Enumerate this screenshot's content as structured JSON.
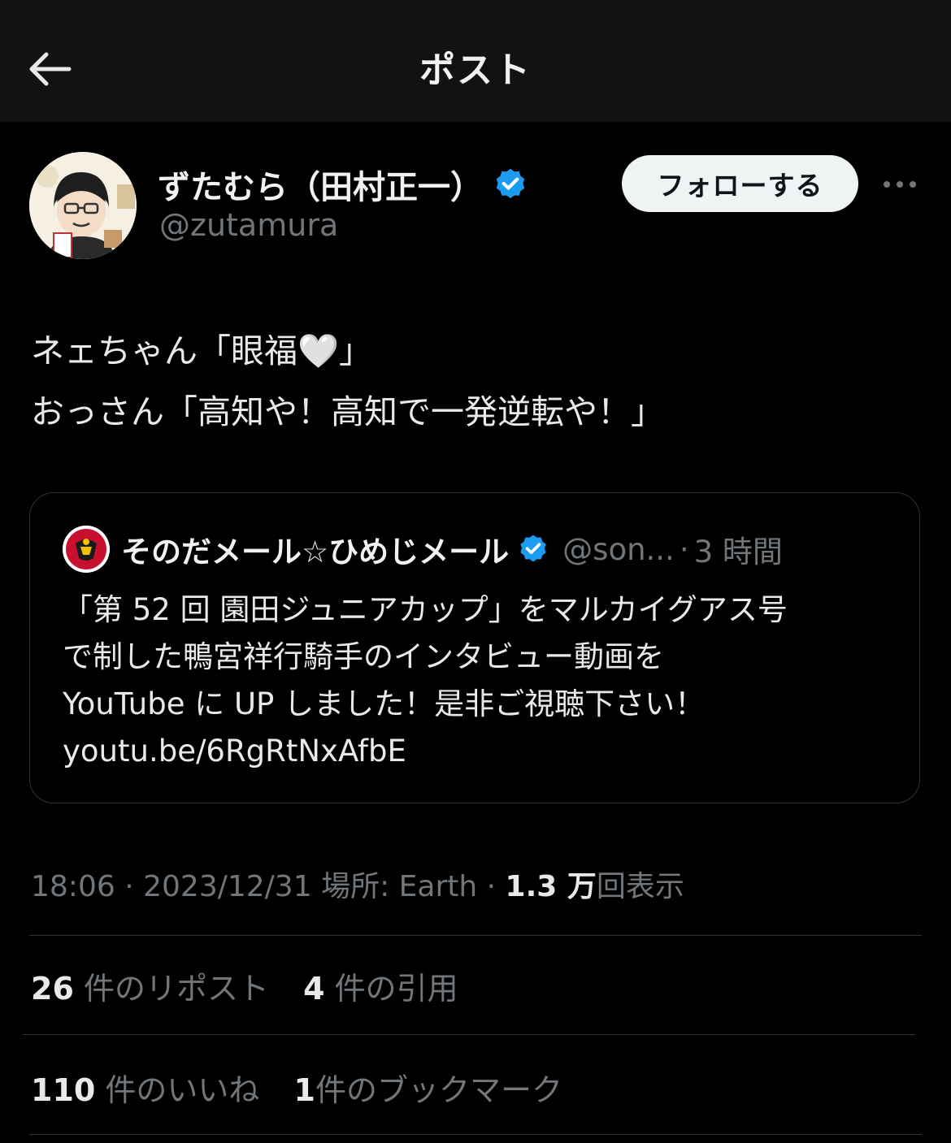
{
  "header": {
    "title": "ポスト",
    "back_icon": "arrow-left-icon"
  },
  "author": {
    "display_name": "ずたむら（田村正一）",
    "handle": "@zutamura",
    "verified": true,
    "verified_color": "#1d9bf0"
  },
  "follow_button": {
    "label": "フォローする"
  },
  "more_icon": "more-dots-icon",
  "tweet": {
    "lines": [
      "ネェちゃん「眼福🤍」",
      "おっさん「高知や！高知で一発逆転や！」"
    ]
  },
  "quote": {
    "display_name": "そのだメール☆ひめじメール",
    "handle": "@son...",
    "separator": "·",
    "time": "3 時間",
    "verified": true,
    "lines": [
      "「第 52 回 園田ジュニアカップ」をマルカイグアス号",
      "で制した鴨宮祥行騎手のインタビュー動画を",
      "YouTube に UP しました！是非ご視聴下さい！",
      "youtu.be/6RgRtNxAfbE"
    ]
  },
  "meta": {
    "time": "18:06",
    "sep1": "·",
    "date": "2023/12/31",
    "location_label": "場所: Earth",
    "sep2": "·",
    "views_count": "1.3 万",
    "views_label": "回表示"
  },
  "stats": {
    "reposts_count": "26",
    "reposts_label": "件のリポスト",
    "quotes_count": "4",
    "quotes_label": "件の引用",
    "likes_count": "110",
    "likes_label": "件のいいね",
    "bookmarks_count": "1",
    "bookmarks_label": "件のブックマーク"
  },
  "colors": {
    "background": "#000000",
    "header_bg": "#121212",
    "muted_text": "#71767b",
    "divider": "#2f3336"
  }
}
